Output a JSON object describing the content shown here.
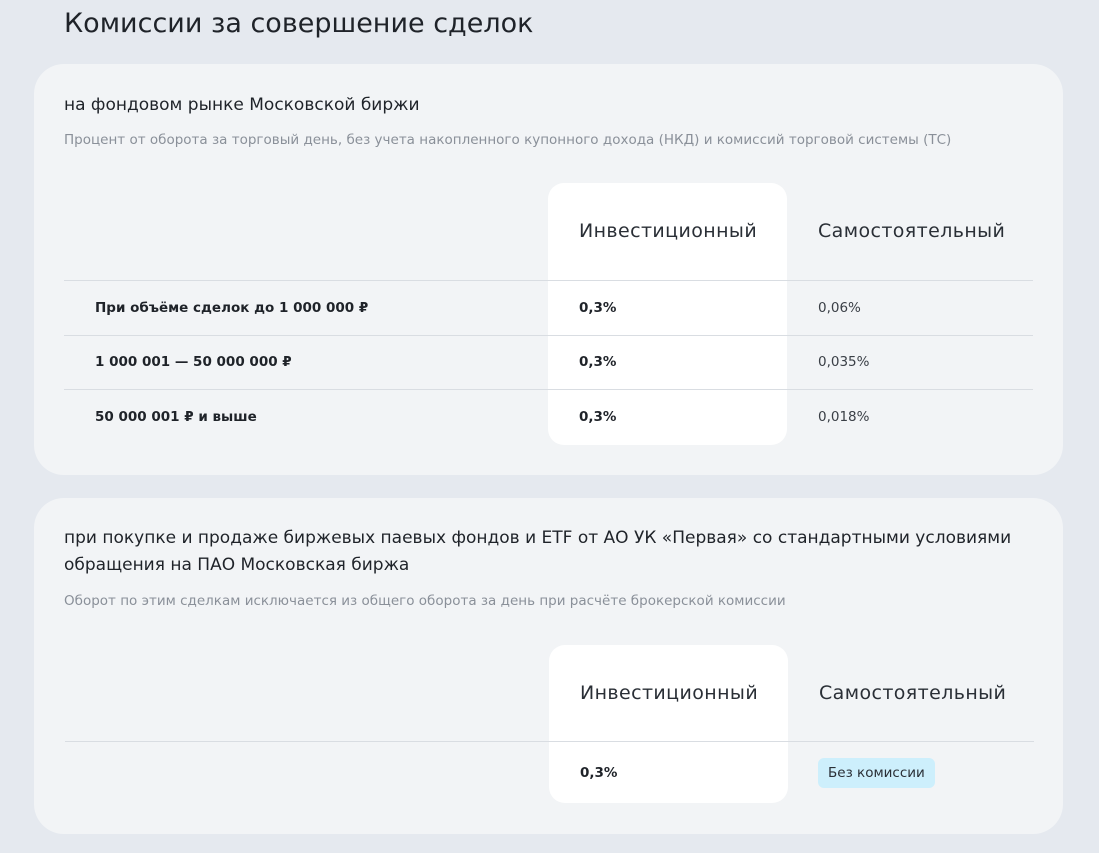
{
  "page": {
    "title": "Комиссии за совершение сделок"
  },
  "section1": {
    "title": "на фондовом рынке Московской биржи",
    "description": "Процент от оборота за торговый день, без учета накопленного купонного дохода (НКД) и комиссий торговой системы (ТС)",
    "columns": [
      "Инвестиционный",
      "Самостоятельный"
    ],
    "rows": [
      {
        "label": "При объёме сделок до 1 000 000 ₽",
        "investment": "0,3%",
        "self": "0,06%"
      },
      {
        "label": "1 000 001 — 50 000 000 ₽",
        "investment": "0,3%",
        "self": "0,035%"
      },
      {
        "label": "50 000 001 ₽ и выше",
        "investment": "0,3%",
        "self": "0,018%"
      }
    ]
  },
  "section2": {
    "title": "при покупке и продаже биржевых паевых фондов и ETF от АО УК «Первая» со стандартными условиями обращения на ПАО Московская биржа",
    "description": "Оборот по этим сделкам исключается из общего оборота за день при расчёте брокерской комиссии",
    "columns": [
      "Инвестиционный",
      "Самостоятельный"
    ],
    "row": {
      "investment": "0,3%",
      "self": "Без комиссии"
    }
  },
  "colors": {
    "background": "#e5e9ef",
    "card": "#f2f4f6",
    "highlight_column": "#ffffff",
    "badge": "#cdeffc"
  }
}
